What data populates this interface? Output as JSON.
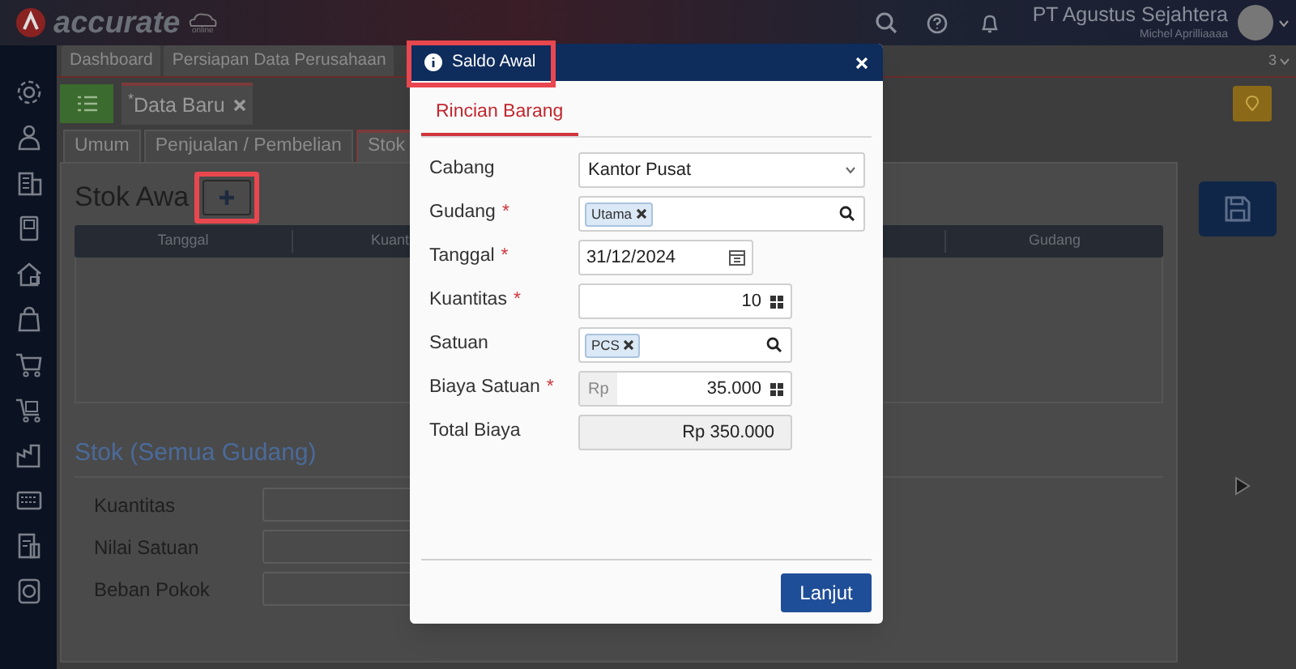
{
  "header": {
    "logo": "accurate",
    "logo_sub": "online",
    "company": "PT Agustus Sejahtera",
    "user": "Michel Aprilliaaaa"
  },
  "top_tabs": [
    {
      "label": "Dashboard",
      "selected": false
    },
    {
      "label": "Persiapan Data Perusahaan",
      "selected": false
    }
  ],
  "tab_count": "3",
  "doc_tab": {
    "marker": "*",
    "label": "Data Baru"
  },
  "sub_tabs": [
    {
      "label": "Umum",
      "selected": false
    },
    {
      "label": "Penjualan / Pembelian",
      "selected": false
    },
    {
      "label": "Stok",
      "selected": true
    }
  ],
  "stock_section": {
    "title": "Stok Awa",
    "columns": [
      "Tanggal",
      "Kuant",
      "Gudang"
    ]
  },
  "summary": {
    "title": "Stok (Semua Gudang)",
    "fields": [
      "Kuantitas",
      "Nilai Satuan",
      "Beban Pokok"
    ]
  },
  "modal": {
    "title": "Saldo Awal",
    "tabs": [
      {
        "label": "Rincian Barang",
        "selected": true
      }
    ],
    "fields": [
      {
        "kind": "select",
        "label": "Cabang",
        "value": "Kantor Pusat"
      },
      {
        "kind": "tags",
        "label": "Gudang",
        "required_mark": "*",
        "tags": [
          "Utama"
        ],
        "wide": true
      },
      {
        "kind": "date",
        "label": "Tanggal",
        "required_mark": "*",
        "value": "31/12/2024"
      },
      {
        "kind": "number",
        "label": "Kuantitas",
        "required_mark": "*",
        "value": "10"
      },
      {
        "kind": "tags",
        "label": "Satuan",
        "tags": [
          "PCS"
        ],
        "wide": false
      },
      {
        "kind": "currency",
        "label": "Biaya Satuan",
        "required_mark": "*",
        "prefix": "Rp",
        "value": "35.000"
      },
      {
        "kind": "readonly",
        "label": "Total Biaya",
        "value": "Rp 350.000"
      }
    ],
    "button": "Lanjut"
  }
}
